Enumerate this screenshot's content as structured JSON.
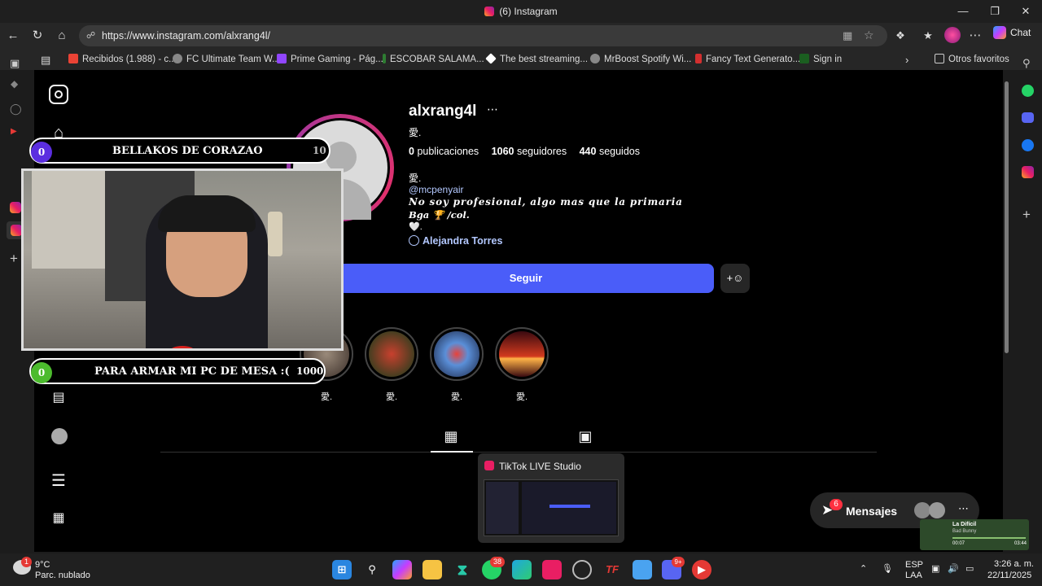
{
  "window": {
    "title": "(6) Instagram"
  },
  "browser": {
    "url": "https://www.instagram.com/alxrang4l/",
    "chat_label": "Chat",
    "bookmarks": [
      {
        "label": "Recibidos (1.988) - c...",
        "color": "#ea4335"
      },
      {
        "label": "FC Ultimate Team W...",
        "color": "#888888"
      },
      {
        "label": "Prime Gaming - Pág...",
        "color": "#9146ff"
      },
      {
        "label": "ESCOBAR SALAMA...",
        "color": "#2e7d32"
      },
      {
        "label": "The best streaming...",
        "color": "#ffffff"
      },
      {
        "label": "MrBoost Spotify Wi...",
        "color": "#888888"
      },
      {
        "label": "Fancy Text Generato...",
        "color": "#d32f2f"
      },
      {
        "label": "Sign in",
        "color": "#1b5e20"
      }
    ],
    "other_favorites": "Otros favoritos"
  },
  "profile": {
    "username": "alxrang4l",
    "kanji_name": "愛.",
    "posts_count": "0",
    "posts_label": "publicaciones",
    "followers_count": "1060",
    "followers_label": "seguidores",
    "following_count": "440",
    "following_label": "seguidos",
    "bio_kanji": "愛.",
    "mention": "@mcpenyair",
    "bio_line1": "𝑵𝒐 𝒔𝒐𝒚 𝒑𝒓𝒐𝒇𝒆𝒔𝒊𝒐𝒏𝒂𝒍, 𝒂𝒍𝒈𝒐 𝒎𝒂𝒔 𝒒𝒖𝒆 𝒍𝒂 𝒑𝒓𝒊𝒎𝒂𝒓𝒊𝒂",
    "bio_line2": "𝑩𝒈𝒂 🏆 /𝒄𝒐𝒍.",
    "bio_line3": "🤍.",
    "facebook_link": "Alejandra Torres",
    "follow_button": "Seguir",
    "highlights": [
      {
        "label": "愛.",
        "color": "#7a6a5a"
      },
      {
        "label": "愛.",
        "color": "#1e6b2a"
      },
      {
        "label": "愛.",
        "color": "#3c6fb4"
      },
      {
        "label": "愛.",
        "color": "#b8321e"
      }
    ]
  },
  "overlay": {
    "top_bar": {
      "count": "0",
      "label": "BELLAKOS DE CORAZAO",
      "goal": "10"
    },
    "bottom_bar": {
      "count": "0",
      "label": "PARA ARMAR MI PC DE MESA :(",
      "goal": "1000"
    }
  },
  "tiktok_preview": {
    "title": "TikTok LIVE Studio"
  },
  "messages": {
    "label": "Mensajes",
    "badge": "6"
  },
  "music": {
    "song": "La Difícil",
    "artist": "Bad Bunny",
    "elapsed": "00:07",
    "total": "03:44"
  },
  "taskbar": {
    "weather_temp": "9°C",
    "weather_desc": "Parc. nublado",
    "weather_badge": "1",
    "whatsapp_badge": "38",
    "discord_badge": "9+",
    "lang1": "ESP",
    "lang2": "LAA",
    "time": "3:26 a. m.",
    "date": "22/11/2025"
  }
}
